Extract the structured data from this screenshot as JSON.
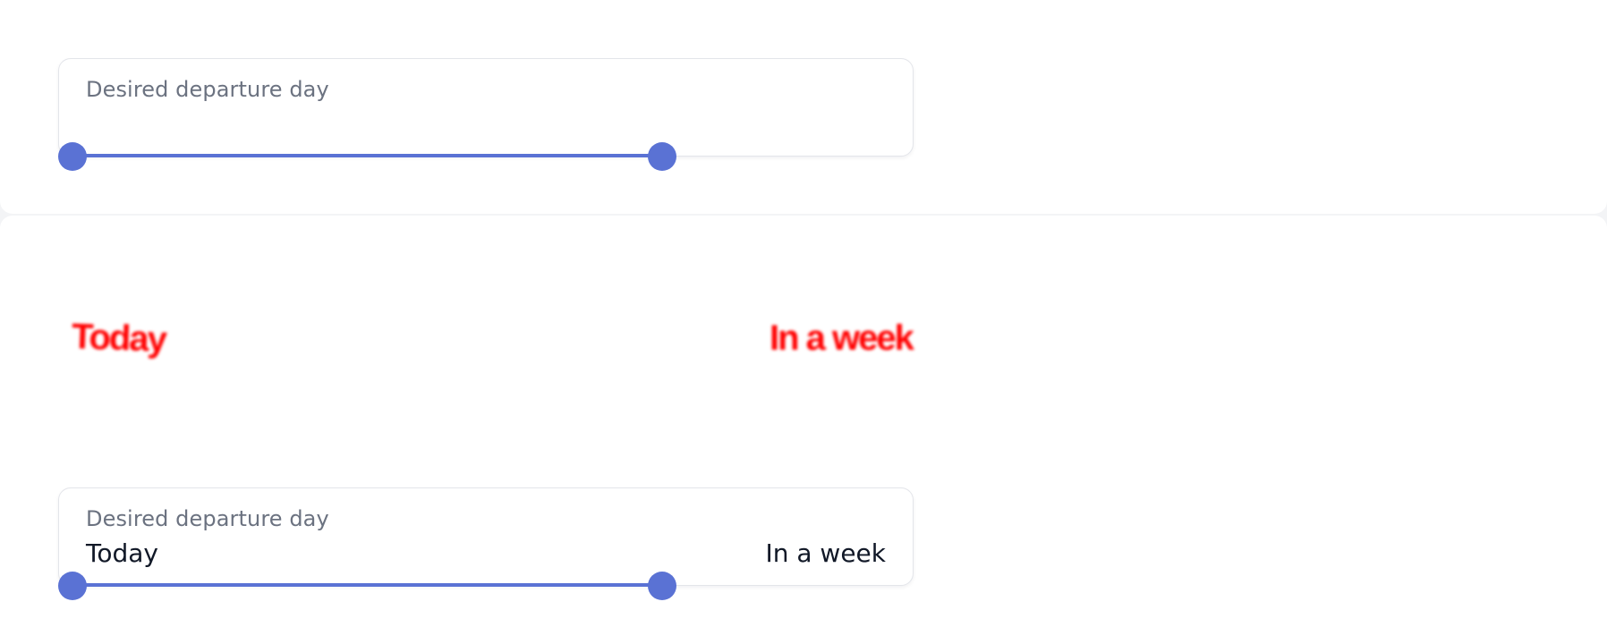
{
  "top_slider": {
    "label": "Desired departure day",
    "range_start": 0.0,
    "range_end": 0.66
  },
  "overlay": {
    "start_text": "Today",
    "end_text": "In a week"
  },
  "bottom_slider": {
    "label": "Desired departure day",
    "start_value": "Today",
    "end_value": "In a week",
    "range_start": 0.0,
    "range_end": 0.66
  },
  "colors": {
    "accent": "#5a72d4",
    "overlay_red": "#ff0000",
    "label_gray": "#6b7280",
    "value_dark": "#111827"
  }
}
